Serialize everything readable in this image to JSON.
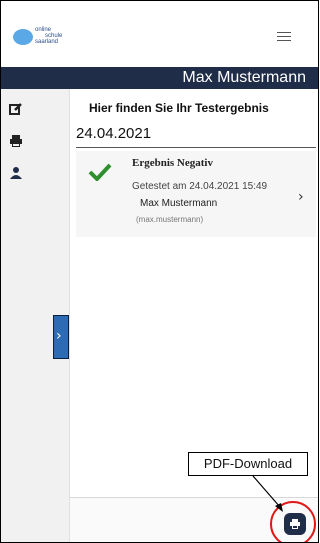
{
  "header": {
    "logo_lines": [
      "online",
      "schule",
      "saarland"
    ],
    "menu_icon": "hamburger-menu-icon"
  },
  "namebar": {
    "user_name": "Max Mustermann"
  },
  "sidebar": {
    "items": [
      {
        "icon": "edit-icon"
      },
      {
        "icon": "print-icon"
      },
      {
        "icon": "user-icon"
      }
    ],
    "toggle_icon": "chevron-right-icon"
  },
  "main": {
    "heading": "Hier finden Sie Ihr Testergebnis",
    "date": "24.04.2021",
    "result": {
      "title": "Ergebnis Negativ",
      "tested_at": "Getestet am 24.04.2021 15:49",
      "name": "Max Mustermann",
      "username": "(max.mustermann)",
      "status_icon": "checkmark-icon",
      "chevron_icon": "chevron-right-icon",
      "status_color": "#2f8f2f"
    }
  },
  "annotation": {
    "label": "PDF-Download"
  },
  "colors": {
    "navy": "#1f2d49",
    "accent": "#2d6cb5",
    "highlight": "#e01818"
  }
}
